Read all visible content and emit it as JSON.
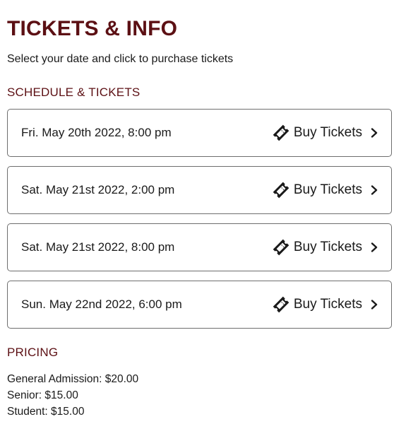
{
  "page": {
    "title": "TICKETS & INFO",
    "intro": "Select your date and click to purchase tickets"
  },
  "schedule": {
    "heading": "SCHEDULE & TICKETS",
    "buy_label": "Buy Tickets",
    "icons": {
      "ticket": "ticket-icon",
      "arrow": "chevron-right-icon"
    },
    "items": [
      {
        "date": "Fri. May 20th 2022, 8:00 pm"
      },
      {
        "date": "Sat. May 21st 2022, 2:00 pm"
      },
      {
        "date": "Sat. May 21st 2022, 8:00 pm"
      },
      {
        "date": "Sun. May 22nd 2022, 6:00 pm"
      }
    ]
  },
  "pricing": {
    "heading": "PRICING",
    "items": [
      "General Admission: $20.00",
      "Senior: $15.00",
      "Student: $15.00"
    ]
  },
  "colors": {
    "accent": "#5c1014",
    "text": "#1a1a1a",
    "border": "#6e6e6e"
  }
}
